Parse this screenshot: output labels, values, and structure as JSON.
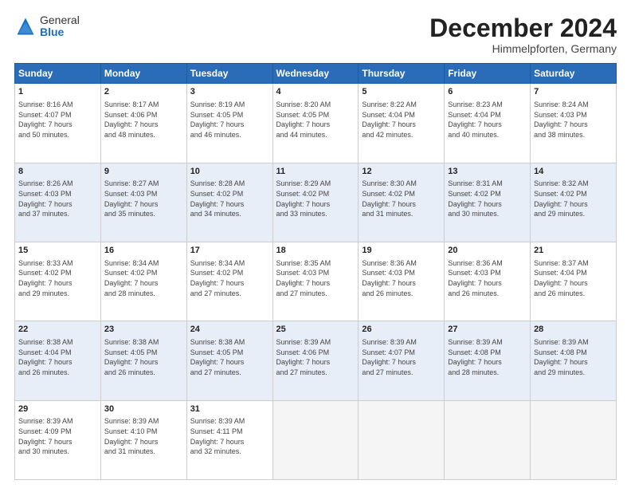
{
  "header": {
    "logo_general": "General",
    "logo_blue": "Blue",
    "month_title": "December 2024",
    "location": "Himmelpforten, Germany"
  },
  "weekdays": [
    "Sunday",
    "Monday",
    "Tuesday",
    "Wednesday",
    "Thursday",
    "Friday",
    "Saturday"
  ],
  "weeks": [
    [
      {
        "day": "1",
        "info": "Sunrise: 8:16 AM\nSunset: 4:07 PM\nDaylight: 7 hours\nand 50 minutes."
      },
      {
        "day": "2",
        "info": "Sunrise: 8:17 AM\nSunset: 4:06 PM\nDaylight: 7 hours\nand 48 minutes."
      },
      {
        "day": "3",
        "info": "Sunrise: 8:19 AM\nSunset: 4:05 PM\nDaylight: 7 hours\nand 46 minutes."
      },
      {
        "day": "4",
        "info": "Sunrise: 8:20 AM\nSunset: 4:05 PM\nDaylight: 7 hours\nand 44 minutes."
      },
      {
        "day": "5",
        "info": "Sunrise: 8:22 AM\nSunset: 4:04 PM\nDaylight: 7 hours\nand 42 minutes."
      },
      {
        "day": "6",
        "info": "Sunrise: 8:23 AM\nSunset: 4:04 PM\nDaylight: 7 hours\nand 40 minutes."
      },
      {
        "day": "7",
        "info": "Sunrise: 8:24 AM\nSunset: 4:03 PM\nDaylight: 7 hours\nand 38 minutes."
      }
    ],
    [
      {
        "day": "8",
        "info": "Sunrise: 8:26 AM\nSunset: 4:03 PM\nDaylight: 7 hours\nand 37 minutes."
      },
      {
        "day": "9",
        "info": "Sunrise: 8:27 AM\nSunset: 4:03 PM\nDaylight: 7 hours\nand 35 minutes."
      },
      {
        "day": "10",
        "info": "Sunrise: 8:28 AM\nSunset: 4:02 PM\nDaylight: 7 hours\nand 34 minutes."
      },
      {
        "day": "11",
        "info": "Sunrise: 8:29 AM\nSunset: 4:02 PM\nDaylight: 7 hours\nand 33 minutes."
      },
      {
        "day": "12",
        "info": "Sunrise: 8:30 AM\nSunset: 4:02 PM\nDaylight: 7 hours\nand 31 minutes."
      },
      {
        "day": "13",
        "info": "Sunrise: 8:31 AM\nSunset: 4:02 PM\nDaylight: 7 hours\nand 30 minutes."
      },
      {
        "day": "14",
        "info": "Sunrise: 8:32 AM\nSunset: 4:02 PM\nDaylight: 7 hours\nand 29 minutes."
      }
    ],
    [
      {
        "day": "15",
        "info": "Sunrise: 8:33 AM\nSunset: 4:02 PM\nDaylight: 7 hours\nand 29 minutes."
      },
      {
        "day": "16",
        "info": "Sunrise: 8:34 AM\nSunset: 4:02 PM\nDaylight: 7 hours\nand 28 minutes."
      },
      {
        "day": "17",
        "info": "Sunrise: 8:34 AM\nSunset: 4:02 PM\nDaylight: 7 hours\nand 27 minutes."
      },
      {
        "day": "18",
        "info": "Sunrise: 8:35 AM\nSunset: 4:03 PM\nDaylight: 7 hours\nand 27 minutes."
      },
      {
        "day": "19",
        "info": "Sunrise: 8:36 AM\nSunset: 4:03 PM\nDaylight: 7 hours\nand 26 minutes."
      },
      {
        "day": "20",
        "info": "Sunrise: 8:36 AM\nSunset: 4:03 PM\nDaylight: 7 hours\nand 26 minutes."
      },
      {
        "day": "21",
        "info": "Sunrise: 8:37 AM\nSunset: 4:04 PM\nDaylight: 7 hours\nand 26 minutes."
      }
    ],
    [
      {
        "day": "22",
        "info": "Sunrise: 8:38 AM\nSunset: 4:04 PM\nDaylight: 7 hours\nand 26 minutes."
      },
      {
        "day": "23",
        "info": "Sunrise: 8:38 AM\nSunset: 4:05 PM\nDaylight: 7 hours\nand 26 minutes."
      },
      {
        "day": "24",
        "info": "Sunrise: 8:38 AM\nSunset: 4:05 PM\nDaylight: 7 hours\nand 27 minutes."
      },
      {
        "day": "25",
        "info": "Sunrise: 8:39 AM\nSunset: 4:06 PM\nDaylight: 7 hours\nand 27 minutes."
      },
      {
        "day": "26",
        "info": "Sunrise: 8:39 AM\nSunset: 4:07 PM\nDaylight: 7 hours\nand 27 minutes."
      },
      {
        "day": "27",
        "info": "Sunrise: 8:39 AM\nSunset: 4:08 PM\nDaylight: 7 hours\nand 28 minutes."
      },
      {
        "day": "28",
        "info": "Sunrise: 8:39 AM\nSunset: 4:08 PM\nDaylight: 7 hours\nand 29 minutes."
      }
    ],
    [
      {
        "day": "29",
        "info": "Sunrise: 8:39 AM\nSunset: 4:09 PM\nDaylight: 7 hours\nand 30 minutes."
      },
      {
        "day": "30",
        "info": "Sunrise: 8:39 AM\nSunset: 4:10 PM\nDaylight: 7 hours\nand 31 minutes."
      },
      {
        "day": "31",
        "info": "Sunrise: 8:39 AM\nSunset: 4:11 PM\nDaylight: 7 hours\nand 32 minutes."
      },
      {
        "day": "",
        "info": ""
      },
      {
        "day": "",
        "info": ""
      },
      {
        "day": "",
        "info": ""
      },
      {
        "day": "",
        "info": ""
      }
    ]
  ]
}
